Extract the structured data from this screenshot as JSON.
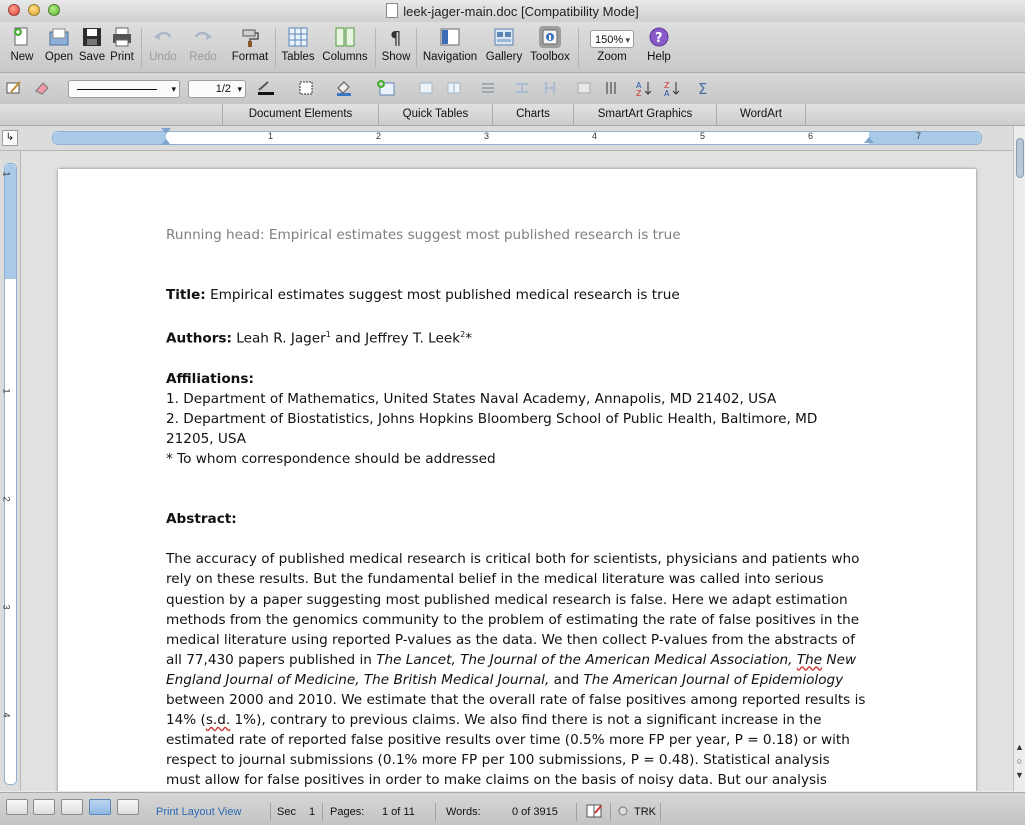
{
  "window": {
    "title": "leek-jager-main.doc [Compatibility Mode]"
  },
  "toolbar": {
    "new": "New",
    "open": "Open",
    "save": "Save",
    "print": "Print",
    "undo": "Undo",
    "redo": "Redo",
    "format": "Format",
    "tables": "Tables",
    "columns": "Columns",
    "show": "Show",
    "navigation": "Navigation",
    "gallery": "Gallery",
    "toolbox": "Toolbox",
    "zoom_label": "Zoom",
    "zoom_value": "150%",
    "help": "Help"
  },
  "format_bar": {
    "page_value": "1/2"
  },
  "ribbon_tabs": [
    "Document Elements",
    "Quick Tables",
    "Charts",
    "SmartArt Graphics",
    "WordArt"
  ],
  "ruler": {
    "numbers": [
      "1",
      "2",
      "3",
      "4",
      "5",
      "6",
      "7"
    ]
  },
  "vertical_ruler": {
    "numbers": [
      "1",
      "1",
      "2",
      "3",
      "4"
    ]
  },
  "document": {
    "running_head": "Running head: Empirical estimates suggest most published research is true",
    "title_label": "Title:",
    "title_text": " Empirical estimates suggest most published medical research is true",
    "authors_label": "Authors:",
    "author1": " Leah R. Jager",
    "author1_sup": "1",
    "author_and": " and Jeffrey T. Leek",
    "author2_sup": "2",
    "author_star": "*",
    "affiliations_label": "Affiliations:",
    "affiliation1": "1. Department of Mathematics, United States Naval Academy, Annapolis, MD 21402, USA",
    "affiliation2": "2. Department of Biostatistics, Johns Hopkins Bloomberg School of Public Health, Baltimore, MD 21205, USA",
    "correspondence": "* To whom correspondence should be addressed",
    "abstract_label": "Abstract:",
    "abstract": {
      "p1": "The accuracy of published medical research is critical both for scientists, physicians and patients who rely on these results. But the fundamental belief in the medical literature was called into serious question by a paper suggesting most published medical research is false. Here we adapt estimation methods from the genomics community to the problem of estimating the rate of false positives in the medical literature using reported P-values as the data. We then collect P-values from the abstracts of all 77,430 papers published in ",
      "j1": "The Lancet, The Journal of the American Medical Association, ",
      "j2": "The",
      "j3": " New England Journal of Medicine, The British Medical Journal,",
      "and": " and ",
      "j4": "The American Journal of Epidemiology",
      "p2": " between 2000 and 2010. We estimate that the overall rate of false positives among reported results is 14% (",
      "sd": "s.d.",
      "p3": " 1%), contrary to previous claims. We also find there is not a significant increase in the estimated rate of reported false positive results over time (0.5% more FP per year, P = 0.18) or with respect to journal submissions (0.1% more FP per 100 submissions, P = 0.48). Statistical analysis must allow for false positives in order to make claims on the basis of noisy data. But our analysis suggests that the medical literature remains a reliable record of scientific progress."
    }
  },
  "status_bar": {
    "view": "Print Layout View",
    "sec_label": "Sec",
    "sec_value": "1",
    "pages_label": "Pages:",
    "pages_value": "1 of 11",
    "words_label": "Words:",
    "words_value": "0 of 3915",
    "trk": "TRK"
  }
}
